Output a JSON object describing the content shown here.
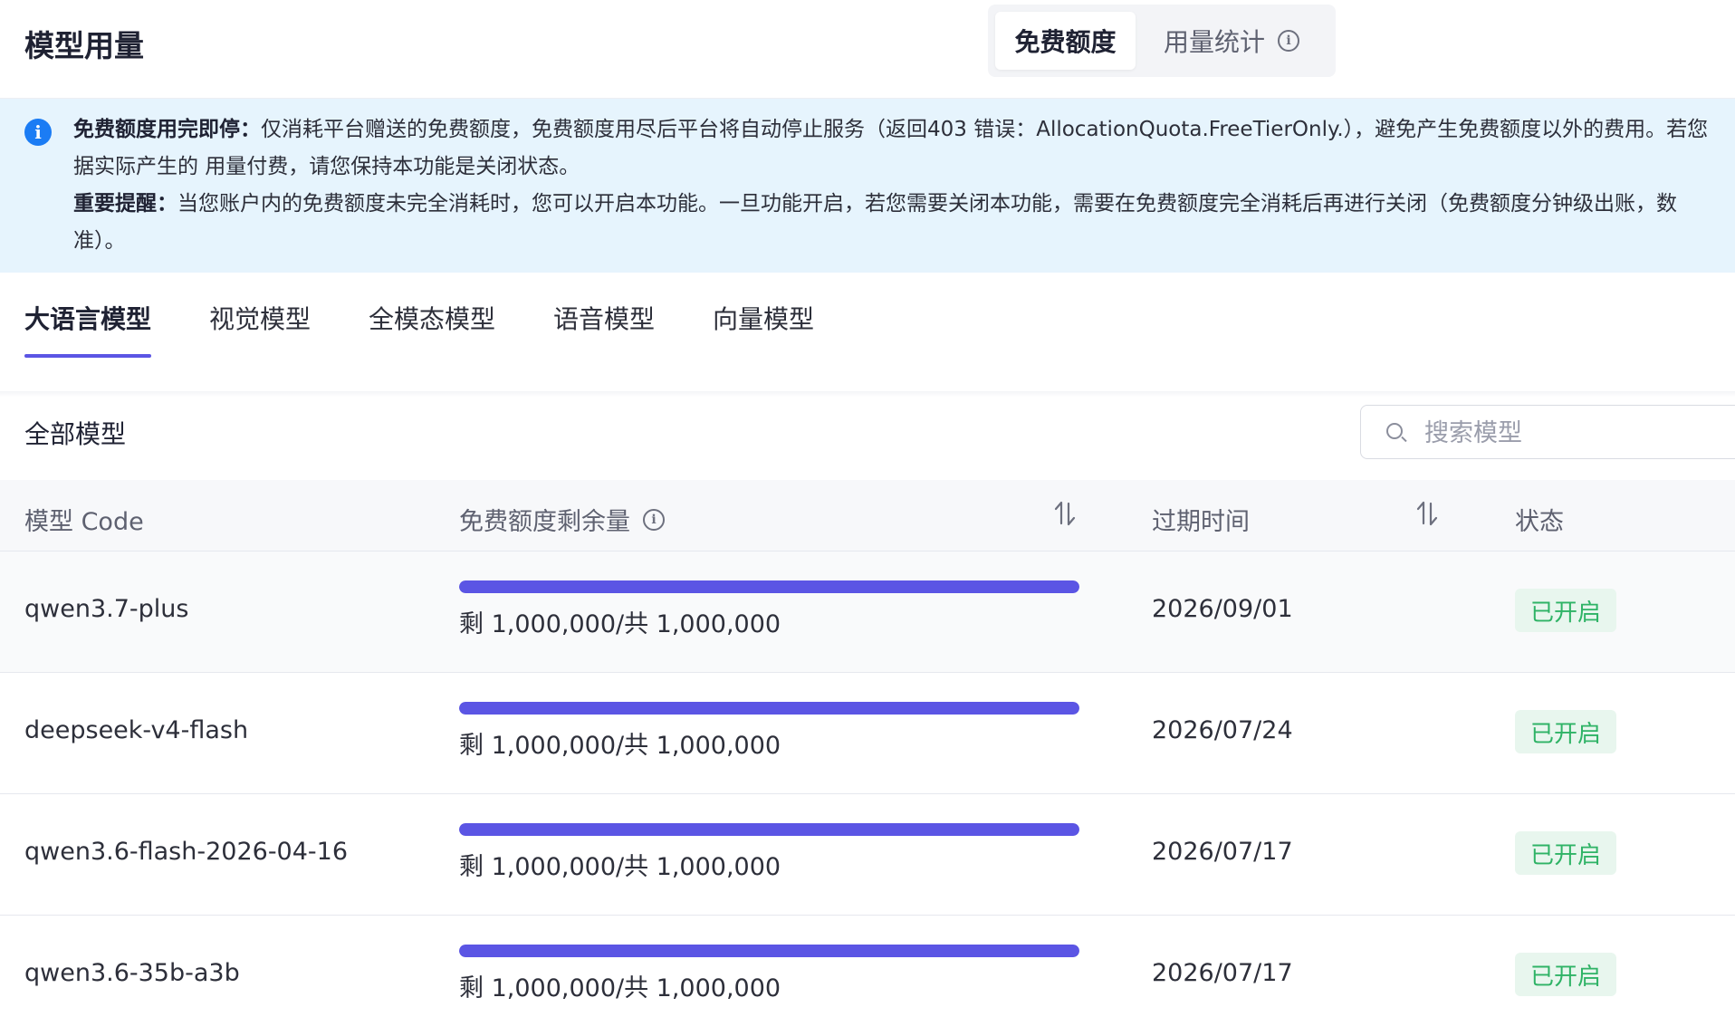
{
  "header": {
    "title": "模型用量",
    "tabs": [
      {
        "label": "免费额度",
        "active": true
      },
      {
        "label": "用量统计",
        "active": false
      }
    ]
  },
  "notice": {
    "line1_bold": "免费额度用完即停：",
    "line1": "仅消耗平台赠送的免费额度，免费额度用尽后平台将自动停止服务（返回403 错误：AllocationQuota.FreeTierOnly.），避免产生免费额度以外的费用。若您",
    "line2": "据实际产生的 用量付费，请您保持本功能是关闭状态。",
    "line3_bold": "重要提醒：",
    "line3": "当您账户内的免费额度未完全消耗时，您可以开启本功能。一旦功能开启，若您需要关闭本功能，需要在免费额度完全消耗后再进行关闭（免费额度分钟级出账，数",
    "line4": "准）。"
  },
  "model_tabs": [
    {
      "label": "大语言模型",
      "active": true
    },
    {
      "label": "视觉模型",
      "active": false
    },
    {
      "label": "全模态模型",
      "active": false
    },
    {
      "label": "语音模型",
      "active": false
    },
    {
      "label": "向量模型",
      "active": false
    }
  ],
  "filter": {
    "section_title": "全部模型",
    "search_placeholder": "搜索模型"
  },
  "table": {
    "columns": {
      "code": "模型 Code",
      "quota": "免费额度剩余量",
      "expire": "过期时间",
      "status": "状态"
    },
    "rows": [
      {
        "code": "qwen3.7-plus",
        "quota_text": "剩 1,000,000/共 1,000,000",
        "remaining_fraction": 1.0,
        "expire": "2026/09/01",
        "status": "已开启"
      },
      {
        "code": "deepseek-v4-flash",
        "quota_text": "剩 1,000,000/共 1,000,000",
        "remaining_fraction": 1.0,
        "expire": "2026/07/24",
        "status": "已开启"
      },
      {
        "code": "qwen3.6-flash-2026-04-16",
        "quota_text": "剩 1,000,000/共 1,000,000",
        "remaining_fraction": 1.0,
        "expire": "2026/07/17",
        "status": "已开启"
      },
      {
        "code": "qwen3.6-35b-a3b",
        "quota_text": "剩 1,000,000/共 1,000,000",
        "remaining_fraction": 1.0,
        "expire": "2026/07/17",
        "status": "已开启"
      }
    ]
  },
  "colors": {
    "accent": "#5b55e4",
    "notice_bg": "#e6f4fd",
    "info_blue": "#1b7cf4",
    "status_green": "#2fb366",
    "status_bg": "#e8f6ee"
  }
}
